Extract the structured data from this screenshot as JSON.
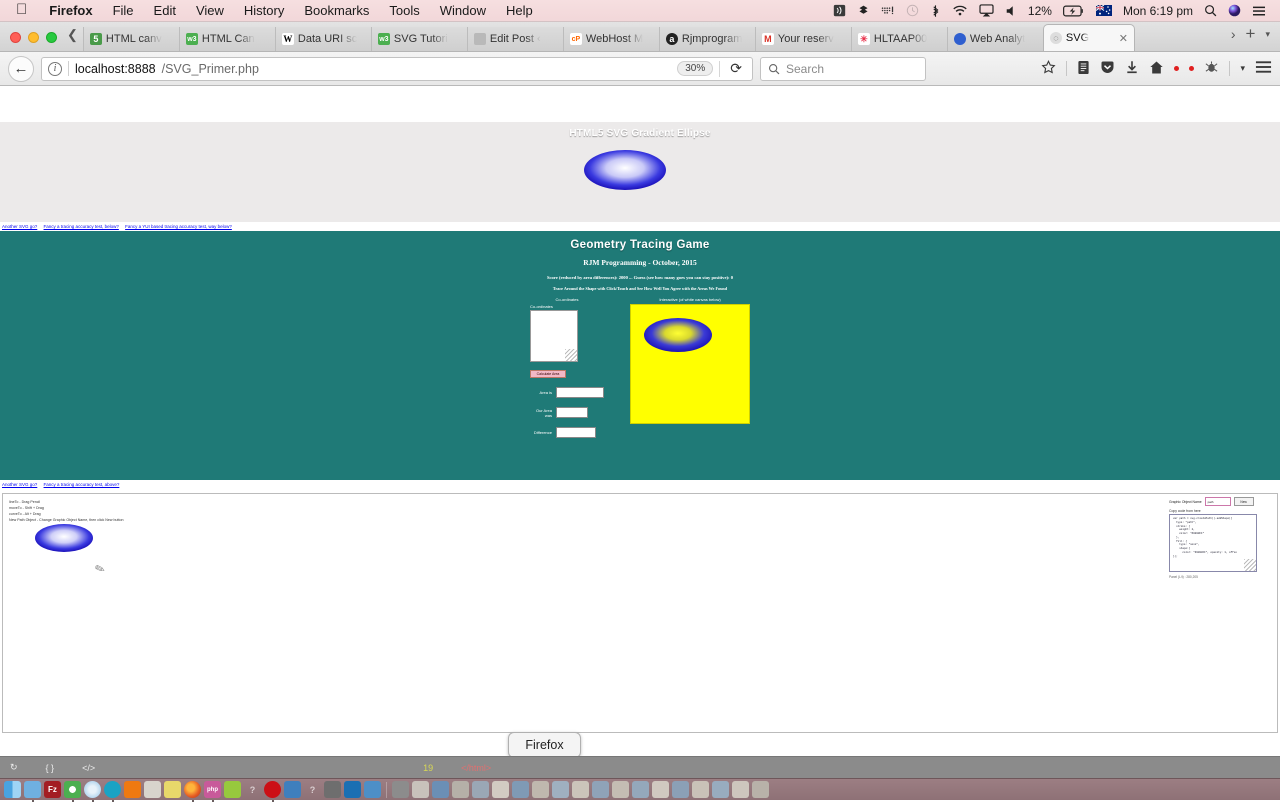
{
  "menubar": {
    "apple_icon": "apple-icon",
    "items": [
      {
        "label": "Firefox",
        "bold": true
      },
      {
        "label": "File",
        "bold": false
      },
      {
        "label": "Edit",
        "bold": false
      },
      {
        "label": "View",
        "bold": false
      },
      {
        "label": "History",
        "bold": false
      },
      {
        "label": "Bookmarks",
        "bold": false
      },
      {
        "label": "Tools",
        "bold": false
      },
      {
        "label": "Window",
        "bold": false
      },
      {
        "label": "Help",
        "bold": false
      }
    ],
    "status": {
      "airplay_audio": "))",
      "dropbox": "dropbox-icon",
      "shortcat": "grid-icon",
      "timemachine": "clock-icon",
      "bluetooth": "bluetooth-icon",
      "wifi": "wifi-icon",
      "airplay": "airplay-icon",
      "volume": "volume-icon",
      "battery_percent": "12%",
      "battery_charging": "charging-icon",
      "flag": "au-flag-icon",
      "clock": "Mon 6:19 pm",
      "spotlight": "search-icon",
      "siri": "siri-icon",
      "notifications": "notification-center-icon"
    }
  },
  "browser": {
    "tabs": [
      {
        "label": "HTML canv",
        "favicon": "html5-icon",
        "fav_color": "#4a9b4a",
        "fav_text": "5",
        "active": false
      },
      {
        "label": "HTML Can",
        "favicon": "w3schools-icon",
        "fav_color": "#4caf50",
        "fav_text": "w3",
        "active": false
      },
      {
        "label": "Data URI sc",
        "favicon": "wikipedia-icon",
        "fav_color": "#ffffff",
        "fav_text": "W",
        "active": false
      },
      {
        "label": "SVG Tutori",
        "favicon": "w3schools-icon",
        "fav_color": "#4caf50",
        "fav_text": "w3",
        "active": false
      },
      {
        "label": "Edit Post ‹",
        "favicon": "wordpress-icon",
        "fav_color": "#9e9e9e",
        "fav_text": "",
        "active": false
      },
      {
        "label": "WebHost M",
        "favicon": "cpanel-icon",
        "fav_color": "#ffffff",
        "fav_text": "cP",
        "active": false
      },
      {
        "label": "Rjmprogram",
        "favicon": "about-icon",
        "fav_color": "#222222",
        "fav_text": "a",
        "active": false
      },
      {
        "label": "Your reserv",
        "favicon": "gmail-icon",
        "fav_color": "#ffffff",
        "fav_text": "M",
        "active": false
      },
      {
        "label": "HLTAAP00",
        "favicon": "asterisk-icon",
        "fav_color": "#ffffff",
        "fav_text": "✳",
        "active": false
      },
      {
        "label": "Web Analyt",
        "favicon": "analytics-icon",
        "fav_color": "#2f5fcf",
        "fav_text": "",
        "active": false
      },
      {
        "label": "SVG",
        "favicon": "svg-icon",
        "fav_color": "#dddddd",
        "fav_text": "◌",
        "active": true
      }
    ],
    "tab_close_glyph": "✕",
    "tab_list_glyph": "›",
    "new_tab_glyph": "+",
    "tab_menu_glyph": "▾",
    "nav": {
      "back_glyph": "←",
      "url_host": "localhost:8888",
      "url_path": "/SVG_Primer.php",
      "zoom_level": "30%",
      "reload_glyph": "⟳",
      "search_placeholder": "Search",
      "icons": [
        "star-icon",
        "reader-icon",
        "pocket-icon",
        "download-icon",
        "home-icon",
        "sync-icon",
        "menu-icon"
      ]
    }
  },
  "page": {
    "hero": {
      "title": "HTML5 SVG Gradient Ellipse"
    },
    "toplinks": [
      "Another SVG go?",
      "Fancy a tracing accuracy test, below?",
      "Fancy a YUI based tracing accuracy test, way below?"
    ],
    "game": {
      "title": "Geometry Tracing Game",
      "subtitle": "RJM Programming - October, 2015",
      "score_line": "Score (reduced by area differences): 2000 ... Guess (see how many goes you can stay positive): 0",
      "instruction": "Trace Around the Shape with Click/Touch and See How Well You Agree with the Areas We Found",
      "left_caption": "Co-ordinates",
      "coord_label": "Co-ordinates",
      "calculate_button": "Calculate Area",
      "fields": [
        {
          "label": "Area is",
          "value": ""
        },
        {
          "label": "Our Area was",
          "value": ""
        },
        {
          "label": "Difference",
          "value": ""
        }
      ],
      "right_caption": "Interactive (of white canvas below)"
    },
    "lowerlinks": [
      "Another SVG go?",
      "Fancy a tracing accuracy test, above?"
    ],
    "editor": {
      "help_lines": [
        "lineTo - Drag Pencil",
        "moveTo - Shift + Drag",
        "curveTo - Alt + Drag",
        "New Path Object - Change Graphic Object Name, then click New button"
      ],
      "pencil_icon": "pencil-icon",
      "code_panel": {
        "name_label": "Graphic Object Name",
        "name_value": "path",
        "new_button": "New",
        "copy_label": "Copy code from here",
        "code": "var path = svg.createPath().addShape({\n  type: \"path\",\n  stroke: {\n    weight: 2,\n    color: \"#0000FF\"\n  },\n  fill: {\n    type: \"none\",\n    shape:{\n      color: \"#0000FF\", opacity: 1, offse\n});",
        "footer": "Panel (L/t) : 280,205"
      }
    }
  },
  "dock": {
    "tooltip": "Firefox",
    "items": [
      {
        "name": "finder-icon",
        "color": "#3d8fd6",
        "glyph": ""
      },
      {
        "name": "preview-icon",
        "color": "#6fb0e0",
        "glyph": ""
      },
      {
        "name": "filezilla-icon",
        "color": "#a31d23",
        "glyph": "Fz"
      },
      {
        "name": "chrome-icon",
        "color": "#4caf50",
        "glyph": ""
      },
      {
        "name": "safari-icon",
        "color": "#cfe3f2",
        "glyph": ""
      },
      {
        "name": "opera-neon-icon",
        "color": "#1aa3c4",
        "glyph": ""
      },
      {
        "name": "vlc-icon",
        "color": "#ef7911",
        "glyph": ""
      },
      {
        "name": "package-icon",
        "color": "#d8d4cc",
        "glyph": ""
      },
      {
        "name": "notes-icon",
        "color": "#e8d86a",
        "glyph": ""
      },
      {
        "name": "firefox-icon",
        "color": "#e55b23",
        "glyph": ""
      },
      {
        "name": "php-icon",
        "color": "#c85a9a",
        "glyph": "php"
      },
      {
        "name": "android-studio-icon",
        "color": "#97c93d",
        "glyph": ""
      },
      {
        "name": "unknown-app-icon",
        "color": "transparent",
        "glyph": "?"
      },
      {
        "name": "opera-icon",
        "color": "#cc0f16",
        "glyph": ""
      },
      {
        "name": "virtualbox-icon",
        "color": "#3f7fbd",
        "glyph": ""
      },
      {
        "name": "unknown-app-2-icon",
        "color": "transparent",
        "glyph": "?"
      },
      {
        "name": "terminal-icon",
        "color": "#6e6e6e",
        "glyph": ""
      },
      {
        "name": "vscode-icon",
        "color": "#1b6fb3",
        "glyph": ""
      },
      {
        "name": "blueprint-icon",
        "color": "#4d8fc7",
        "glyph": ""
      }
    ],
    "editor_strip": {
      "line_number": "19",
      "tag_text": "</html>"
    }
  }
}
